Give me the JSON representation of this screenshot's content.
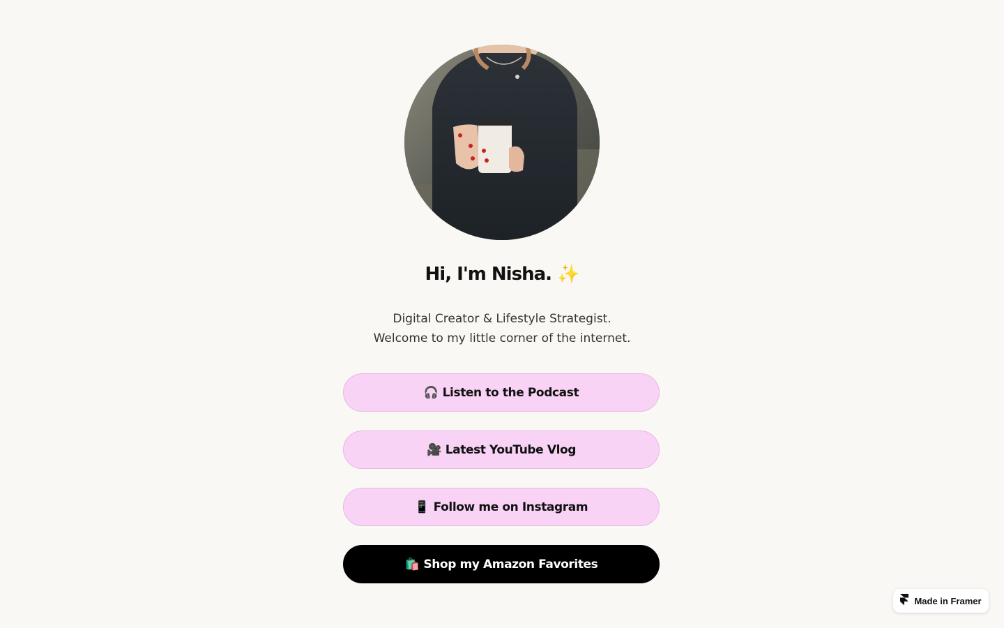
{
  "profile": {
    "headline": "Hi, I'm Nisha. ✨",
    "bio_line1": "Digital Creator & Lifestyle Strategist.",
    "bio_line2": "Welcome to my little corner of the internet."
  },
  "links": [
    {
      "icon": "headphones-icon",
      "emoji": "🎧",
      "label": "Listen to the Podcast"
    },
    {
      "icon": "video-camera-icon",
      "emoji": "🎥",
      "label": "Latest YouTube Vlog"
    },
    {
      "icon": "mobile-phone-icon",
      "emoji": "📱",
      "label": "Follow me on Instagram"
    },
    {
      "icon": "shopping-bags-icon",
      "emoji": "🛍️",
      "label": "Shop my Amazon Favorites"
    }
  ],
  "badge": {
    "icon": "framer-logo-icon",
    "label": "Made in Framer"
  },
  "colors": {
    "background": "#faf8f5",
    "link_button": "#f9d3f6",
    "link_button_border": "#e7b7e3",
    "primary_button": "#000000",
    "text": "#111111"
  }
}
